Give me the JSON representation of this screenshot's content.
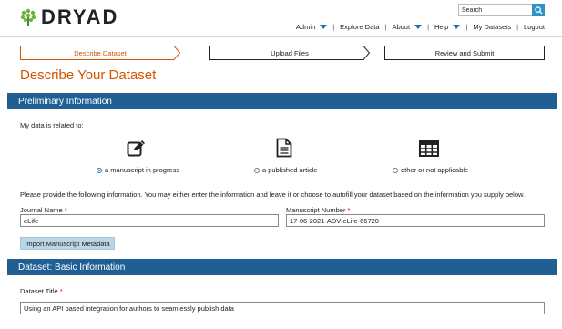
{
  "brand": {
    "name": "DRYAD"
  },
  "search": {
    "placeholder": "Search"
  },
  "nav": [
    {
      "label": "Admin",
      "dropdown": true
    },
    {
      "label": "Explore Data",
      "dropdown": false
    },
    {
      "label": "About",
      "dropdown": true
    },
    {
      "label": "Help",
      "dropdown": true
    },
    {
      "label": "My Datasets",
      "dropdown": false
    },
    {
      "label": "Logout",
      "dropdown": false
    }
  ],
  "steps": [
    {
      "label": "Describe Dataset",
      "active": true
    },
    {
      "label": "Upload Files",
      "active": false
    },
    {
      "label": "Review and Submit",
      "active": false
    }
  ],
  "page_title": "Describe Your Dataset",
  "preliminary": {
    "heading": "Preliminary Information",
    "related_prompt": "My data is related to:",
    "options": [
      {
        "label": "a manuscript in progress",
        "icon": "edit-icon",
        "checked": true
      },
      {
        "label": "a published article",
        "icon": "document-icon",
        "checked": false
      },
      {
        "label": "other or not applicable",
        "icon": "table-icon",
        "checked": false
      }
    ],
    "instructions": "Please provide the following information. You may either enter the information and leave it or choose to autofill your dataset based on the information you supply below.",
    "journal_label": "Journal Name",
    "journal_value": "eLife",
    "manuscript_label": "Manuscript Number",
    "manuscript_value": "17-06-2021-ADV-eLife-66720",
    "required_mark": "*",
    "import_button": "Import Manuscript Metadata"
  },
  "basic": {
    "heading": "Dataset: Basic Information",
    "title_label": "Dataset Title",
    "title_value": "Using an API based integration for authors to seamlessly publish data"
  },
  "colors": {
    "accent": "#d35400",
    "band": "#1f5f94",
    "link_blue": "#1f6fa6",
    "search_button": "#2e94c4",
    "import_button": "#b9d7e6",
    "required": "#d0021b"
  }
}
